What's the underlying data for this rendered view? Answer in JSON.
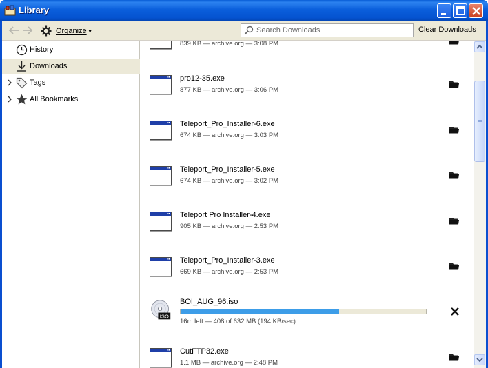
{
  "window": {
    "title": "Library"
  },
  "toolbar": {
    "organize_label": "Organize",
    "search_placeholder": "Search Downloads",
    "clear_label": "Clear Downloads"
  },
  "sidebar": {
    "items": [
      {
        "label": "History",
        "icon": "clock-icon"
      },
      {
        "label": "Downloads",
        "icon": "download-arrow-icon",
        "selected": true
      },
      {
        "label": "Tags",
        "icon": "tag-icon"
      },
      {
        "label": "All Bookmarks",
        "icon": "star-icon"
      }
    ]
  },
  "downloads": [
    {
      "name": "",
      "status": "839 KB — archive.org — 3:08 PM"
    },
    {
      "name": "pro12-35.exe",
      "status": "877 KB — archive.org — 3:06 PM"
    },
    {
      "name": "Teleport_Pro_Installer-6.exe",
      "status": "674 KB — archive.org — 3:03 PM"
    },
    {
      "name": "Teleport_Pro_Installer-5.exe",
      "status": "674 KB — archive.org — 3:02 PM"
    },
    {
      "name": "Teleport Pro Installer-4.exe",
      "status": "905 KB — archive.org — 2:53 PM"
    },
    {
      "name": "Teleport_Pro_Installer-3.exe",
      "status": "669 KB — archive.org — 2:53 PM"
    },
    {
      "name": "BOI_AUG_96.iso",
      "status": "16m left — 408 of 632 MB (194 KB/sec)",
      "progress": 0.645,
      "iso_badge": "ISO"
    },
    {
      "name": "CutFTP32.exe",
      "status": "1.1 MB — archive.org — 2:48 PM"
    }
  ],
  "colors": {
    "titlebar": "#0b5fdc",
    "progress_fill": "#3d9de8",
    "toolbar_bg": "#ece9d8"
  }
}
